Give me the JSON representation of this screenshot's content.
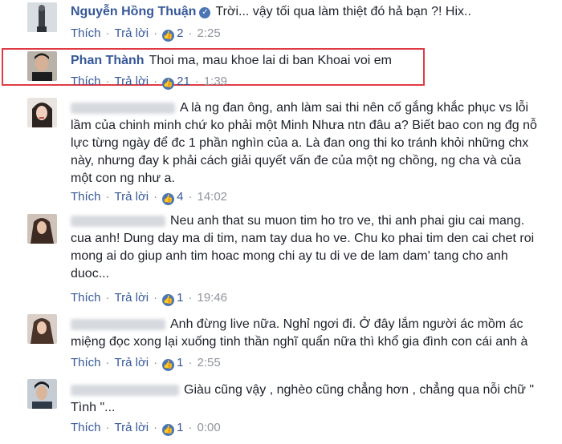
{
  "comments": [
    {
      "author": "Nguyễn Hồng Thuận",
      "text": "Trời... vậy tối qua làm thiệt đó hả bạn ?! Hix..",
      "like_label": "Thích",
      "reply_label": "Trả lời",
      "likes": "2",
      "time": "2:25"
    },
    {
      "author": "Phan Thành",
      "text": "Thoi ma, mau khoe lai di ban Khoai voi em",
      "like_label": "Thích",
      "reply_label": "Trả lời",
      "likes": "21",
      "time": "1:39"
    },
    {
      "author": "",
      "text": "A là ng đan ông, anh làm sai thi nên cố gắng khắc phục vs lỗi lầm của chinh minh chứ ko phải một Minh Nhưa ntn đâu a? Biết bao con ng đg nỗ lực từng ngày để đc 1 phần nghìn của a. Là đan ong thi ko tránh khỏi những chx này, nhưng đay k phải cách giải quyết vấn đe của một ng chồng, ng cha và của một con ng như a.",
      "like_label": "Thích",
      "reply_label": "Trả lời",
      "likes": "4",
      "time": "14:02"
    },
    {
      "author": "",
      "text": "Neu anh that su muon tim ho tro ve, thi anh phai giu cai mang. cua anh! Dung day ma di tim, nam tay dua ho ve. Chu ko phai tim den cai chet roi mong ai do giup anh tim hoac mong chi ay tu di ve de lam dam' tang cho anh duoc...",
      "like_label": "Thích",
      "reply_label": "Trả lời",
      "likes": "1",
      "time": "19:46"
    },
    {
      "author": "",
      "text": "Anh đừng live nữa. Nghỉ ngơi đi. Ở đây lắm người ác mồm ác miệng đọc xong lại xuống tinh thần nghĩ quẩn nữa thì khổ gia đình con cái anh à",
      "like_label": "Thích",
      "reply_label": "Trả lời",
      "likes": "1",
      "time": "2:55"
    },
    {
      "author": "",
      "text": "Giàu cũng vậy , nghèo cũng chẳng hơn , chẳng qua nỗi chữ \" Tình \"...",
      "like_label": "Thích",
      "reply_label": "Trả lời",
      "likes": "1",
      "time": "0:00"
    }
  ],
  "icons": {
    "like": "thumbs-up-icon",
    "verified": "verified-check-icon"
  },
  "colors": {
    "author": "#365899",
    "highlight": "#e03b44",
    "like_badge": "#4a76b5"
  }
}
